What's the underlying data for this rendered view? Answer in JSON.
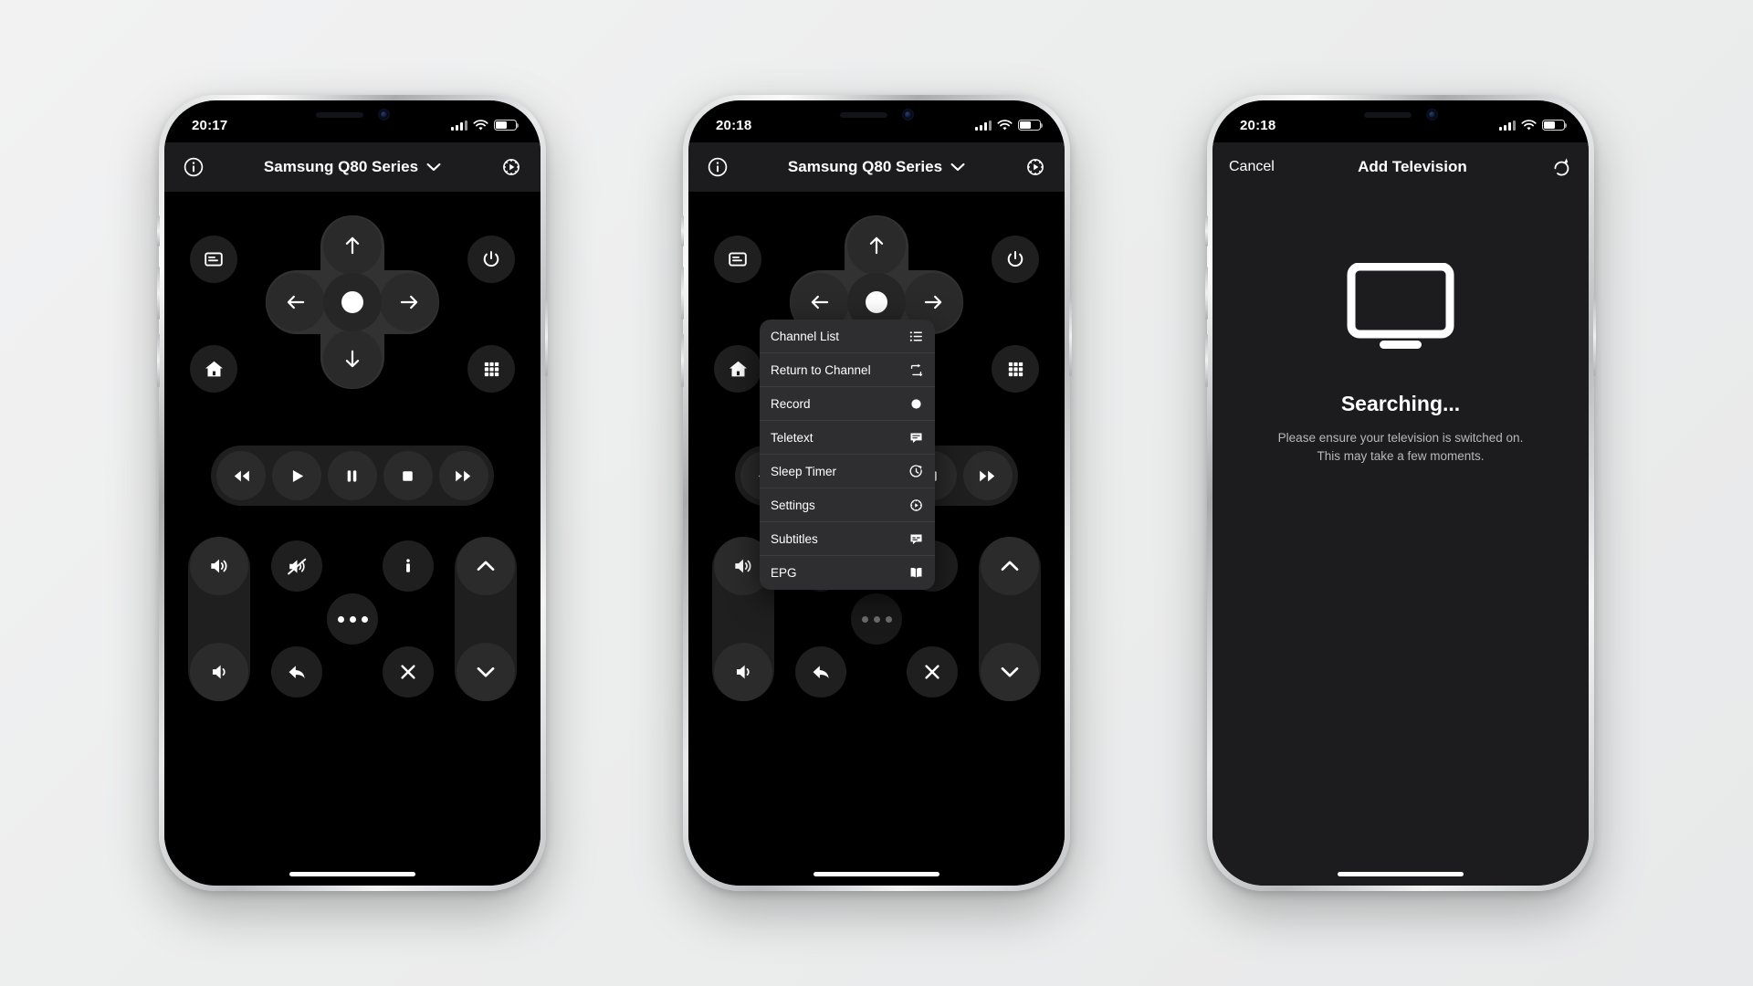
{
  "phones": [
    {
      "id": "remote-default",
      "status": {
        "time": "20:17",
        "battery_level": 55,
        "signal_icon": "cellular-bars-icon",
        "wifi_icon": "wifi-icon",
        "battery_icon": "battery-icon"
      },
      "header": {
        "info_icon": "info-circle-icon",
        "title": "Samsung Q80 Series",
        "chevron_icon": "chevron-down-icon",
        "settings_icon": "gear-icon"
      },
      "menu_open": false
    },
    {
      "id": "remote-menu-open",
      "status": {
        "time": "20:18",
        "battery_level": 55,
        "signal_icon": "cellular-bars-icon",
        "wifi_icon": "wifi-icon",
        "battery_icon": "battery-icon"
      },
      "header": {
        "info_icon": "info-circle-icon",
        "title": "Samsung Q80 Series",
        "chevron_icon": "chevron-down-icon",
        "settings_icon": "gear-icon"
      },
      "menu_open": true
    },
    {
      "id": "add-television",
      "status": {
        "time": "20:18",
        "battery_level": 55,
        "signal_icon": "cellular-bars-icon",
        "wifi_icon": "wifi-icon",
        "battery_icon": "battery-icon"
      }
    }
  ],
  "remote": {
    "corner_buttons": [
      {
        "name": "source-input-button",
        "icon": "source-input-icon"
      },
      {
        "name": "power-button",
        "icon": "power-icon"
      },
      {
        "name": "home-button",
        "icon": "home-icon"
      },
      {
        "name": "apps-grid-button",
        "icon": "grid-apps-icon"
      }
    ],
    "dpad": {
      "up": "dpad-up-arrow-icon",
      "down": "dpad-down-arrow-icon",
      "left": "dpad-left-arrow-icon",
      "right": "dpad-right-arrow-icon",
      "ok": "dpad-ok-button"
    },
    "media_buttons": [
      {
        "name": "rewind-button",
        "icon": "rewind-icon"
      },
      {
        "name": "play-button",
        "icon": "play-icon"
      },
      {
        "name": "pause-button",
        "icon": "pause-icon"
      },
      {
        "name": "stop-button",
        "icon": "stop-icon"
      },
      {
        "name": "fast-forward-button",
        "icon": "fast-forward-icon"
      }
    ],
    "volume": {
      "up": "volume-up-icon",
      "down": "volume-down-icon"
    },
    "channel": {
      "up": "chevron-up-icon",
      "down": "chevron-down-icon"
    },
    "center_buttons": [
      {
        "name": "mute-button",
        "icon": "mute-icon"
      },
      {
        "name": "info-button",
        "icon": "info-i-icon"
      },
      {
        "name": "more-button",
        "icon": "ellipsis-icon"
      },
      {
        "name": "back-button",
        "icon": "back-arrow-icon"
      },
      {
        "name": "exit-button",
        "icon": "close-x-icon"
      }
    ]
  },
  "popup_menu": {
    "items": [
      {
        "label": "Channel List",
        "icon": "list-icon"
      },
      {
        "label": "Return to Channel",
        "icon": "return-loop-icon"
      },
      {
        "label": "Record",
        "icon": "record-dot-icon"
      },
      {
        "label": "Teletext",
        "icon": "teletext-bubble-icon"
      },
      {
        "label": "Sleep Timer",
        "icon": "sleep-timer-icon"
      },
      {
        "label": "Settings",
        "icon": "settings-play-icon"
      },
      {
        "label": "Subtitles",
        "icon": "subtitles-icon"
      },
      {
        "label": "EPG",
        "icon": "book-icon"
      }
    ]
  },
  "add_television": {
    "cancel_label": "Cancel",
    "title": "Add Television",
    "refresh_icon": "refresh-icon",
    "tv_icon": "television-icon",
    "status_title": "Searching...",
    "status_line1": "Please ensure your television is switched on.",
    "status_line2": "This may take a few moments."
  },
  "colors": {
    "background": "#eceded",
    "screen_black": "#000000",
    "panel": "#1c1c1e",
    "button": "#2b2b2b",
    "pill": "#1f1f1f",
    "menu": "#2c2c2e",
    "text": "#ffffff",
    "subtext": "#b8b8bd"
  }
}
